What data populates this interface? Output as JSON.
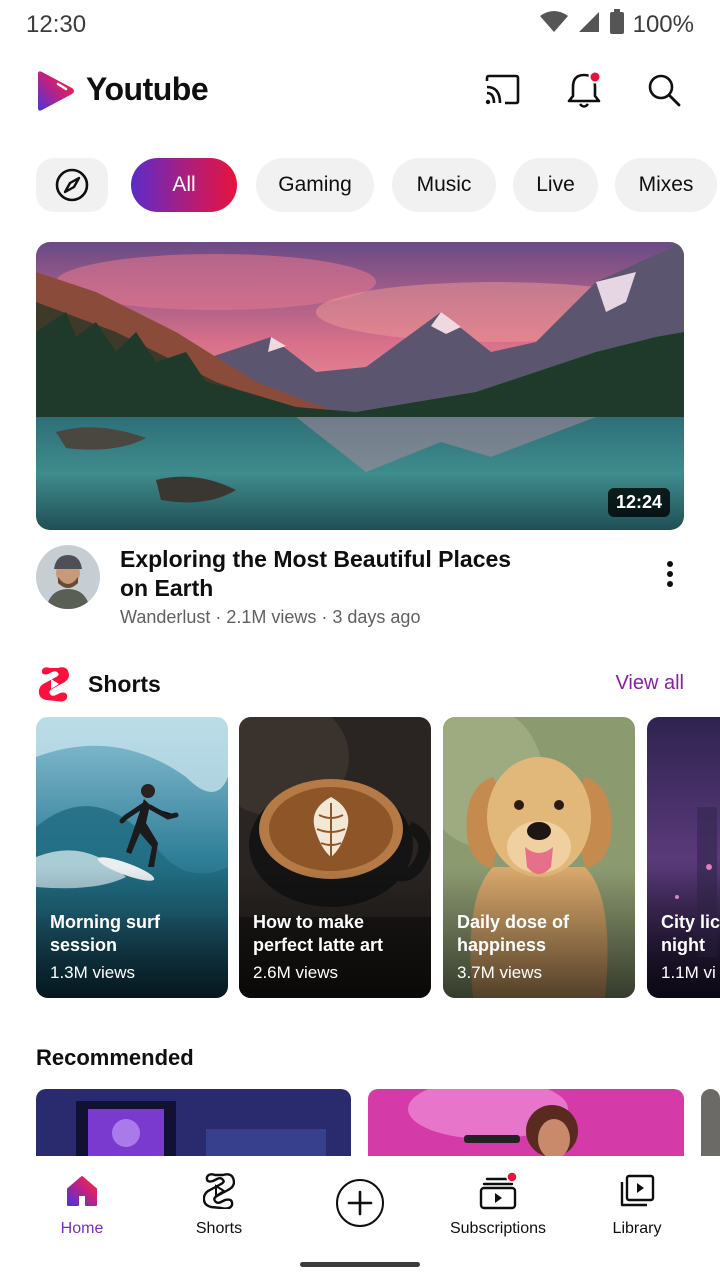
{
  "status_bar": {
    "time": "12:30",
    "battery": "100%"
  },
  "header": {
    "title": "Youtube"
  },
  "chips": [
    {
      "label": "All"
    },
    {
      "label": "Gaming"
    },
    {
      "label": "Music"
    },
    {
      "label": "Live"
    },
    {
      "label": "Mixes"
    }
  ],
  "featured": {
    "duration": "12:24",
    "title": "Exploring the Most Beautiful Places on Earth",
    "meta": "Wanderlust · 2.1M views · 3 days ago"
  },
  "shorts": {
    "title": "Shorts",
    "view_all": "View all",
    "items": [
      {
        "title": "Morning surf\nsession",
        "views": "1.3M views"
      },
      {
        "title": "How to make\nperfect latte art",
        "views": "2.6M views"
      },
      {
        "title": "Daily dose of\nhappiness",
        "views": "3.7M views"
      },
      {
        "title": "City lic\nnight",
        "views": "1.1M vi"
      }
    ]
  },
  "recommended": {
    "title": "Recommended"
  },
  "bottom_nav": {
    "home": "Home",
    "shorts": "Shorts",
    "subscriptions": "Subscriptions",
    "library": "Library"
  },
  "colors": {
    "accent_start": "#5b2cc9",
    "accent_end": "#e6143d",
    "notification_dot": "#e8123c",
    "view_all": "#8a1ea8",
    "active_nav": "#7b2ec7"
  }
}
